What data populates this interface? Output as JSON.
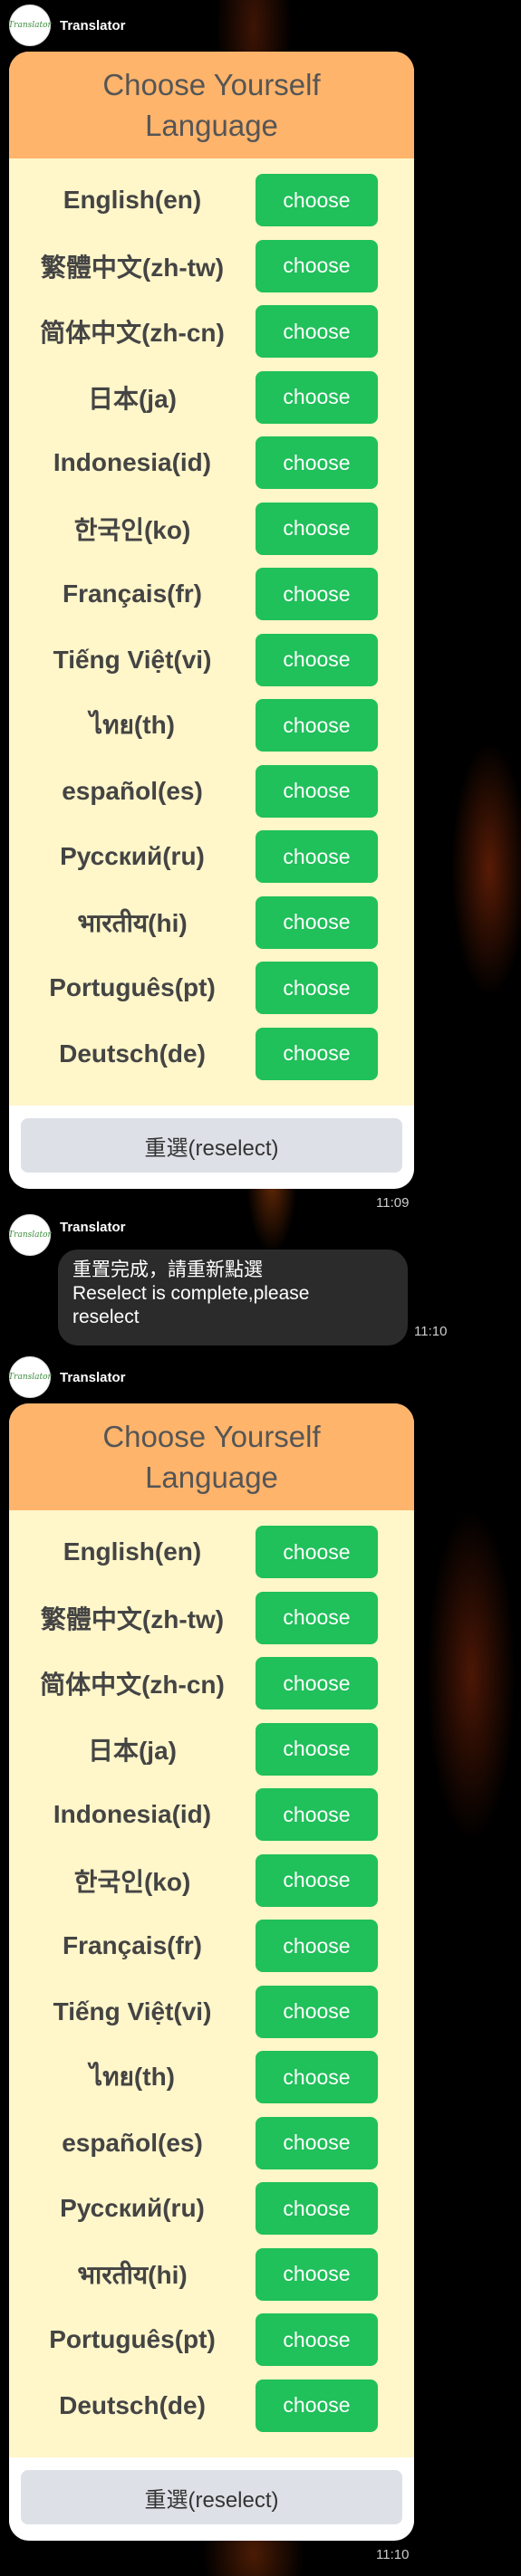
{
  "sender": {
    "name": "Translator",
    "avatar_text": "Translator"
  },
  "card": {
    "title_line1": "Choose Yourself",
    "title_line2": "Language",
    "choose_label": "choose",
    "reselect_label": "重選(reselect)",
    "languages": [
      "English(en)",
      "繁體中文(zh-tw)",
      "简体中文(zh-cn)",
      "日本(ja)",
      "Indonesia(id)",
      "한국인(ko)",
      "Français(fr)",
      "Tiếng Việt(vi)",
      "ไทย(th)",
      "español(es)",
      "Русский(ru)",
      "भारतीय(hi)",
      "Português(pt)",
      "Deutsch(de)"
    ]
  },
  "messages": [
    {
      "type": "card",
      "time": "11:09"
    },
    {
      "type": "text",
      "text_line1": "重置完成，請重新點選",
      "text_line2": "Reselect is complete,please",
      "text_line3": "reselect",
      "time": "11:10"
    },
    {
      "type": "card",
      "time": "11:10"
    }
  ]
}
